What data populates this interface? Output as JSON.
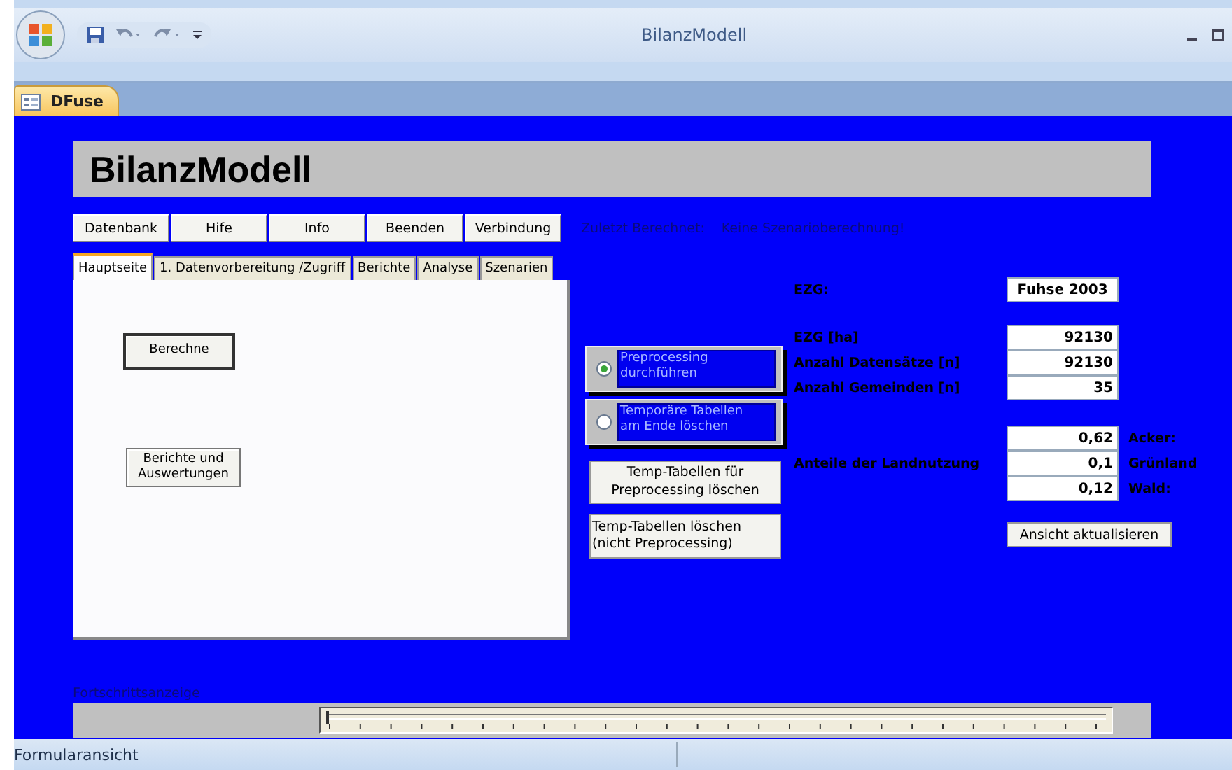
{
  "window": {
    "title": "BilanzModell"
  },
  "document_tab": {
    "label": "DFuse"
  },
  "form": {
    "title": "BilanzModell",
    "nav_buttons": [
      "Datenbank",
      "Hife",
      "Info",
      "Beenden",
      "Verbindung"
    ],
    "last_calc": {
      "label": "Zuletzt Berechnet:",
      "value": "Keine Szenarioberechnung!"
    },
    "tabs": [
      {
        "label": "Hauptseite",
        "selected": true
      },
      {
        "label": "1. Datenvorbereitung /Zugriff",
        "selected": false
      },
      {
        "label": "Berichte",
        "selected": false
      },
      {
        "label": "Analyse",
        "selected": false
      },
      {
        "label": "Szenarien",
        "selected": false
      }
    ],
    "panel_buttons": [
      "Berechne",
      "Berichte und\nAuswertungen"
    ],
    "options": [
      {
        "label": "Preprocessing\ndurchführen",
        "selected": true
      },
      {
        "label": "Temporäre Tabellen\nam Ende löschen",
        "selected": false
      }
    ],
    "action_buttons": [
      "Temp-Tabellen für\nPreprocessing löschen",
      "Temp-Tabellen löschen\n   (nicht Preprocessing)"
    ],
    "ezg": {
      "label": "EZG:",
      "value": "Fuhse 2003"
    },
    "stats": [
      {
        "label": "EZG [ha]",
        "value": "92130"
      },
      {
        "label": "Anzahl Datensätze [n]",
        "value": "92130"
      },
      {
        "label": "Anzahl Gemeinden [n]",
        "value": "35"
      }
    ],
    "landuse": {
      "label": "Anteile der Landnutzung",
      "rows": [
        {
          "value": "0,62",
          "label": "Acker:"
        },
        {
          "value": "0,1",
          "label": "Grünland"
        },
        {
          "value": "0,12",
          "label": "Wald:"
        }
      ]
    },
    "refresh_button": "Ansicht aktualisieren",
    "progress": {
      "label": "Fortschrittsanzeige",
      "level": 0
    }
  },
  "status_bar": {
    "text": "Formularansicht"
  }
}
